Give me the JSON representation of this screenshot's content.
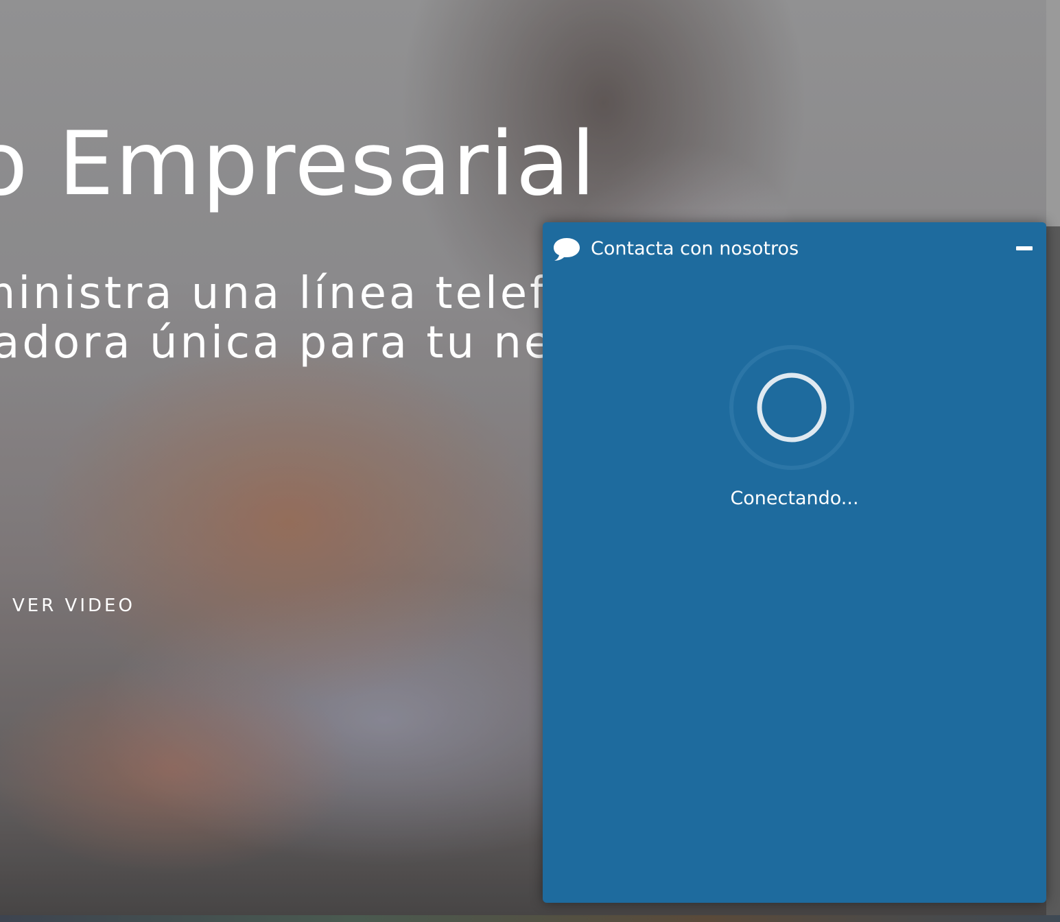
{
  "hero": {
    "title": "o Empresarial",
    "subtitle_line1": "ministra una línea telefó",
    "subtitle_line2": "tadora única para tu ne",
    "video_link": "VER VIDEO"
  },
  "chat": {
    "title": "Contacta con nosotros",
    "status": "Conectando...",
    "header_color": "#1e6b9e",
    "icons": {
      "header": "speech-bubble-icon",
      "minimize": "minimize-icon",
      "loading": "loading-spinner-icon"
    }
  }
}
